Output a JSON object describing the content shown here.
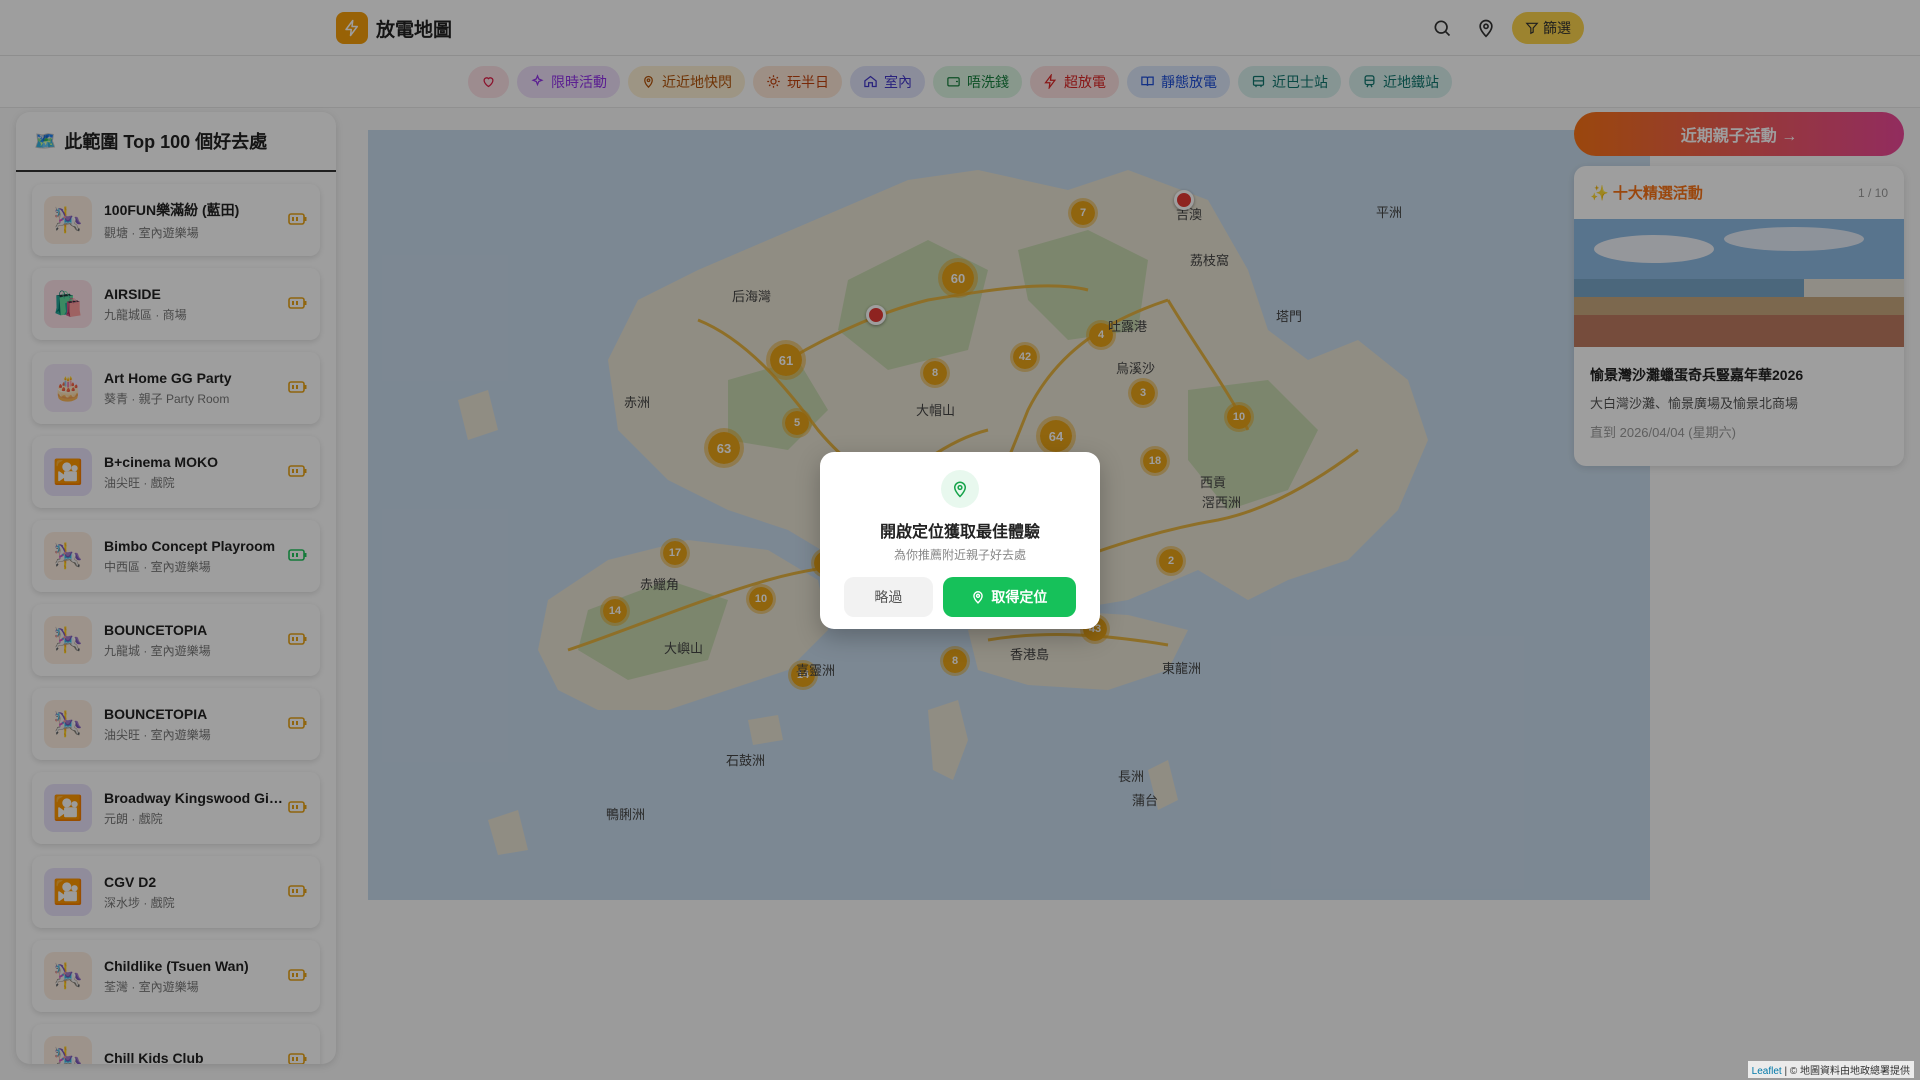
{
  "app": {
    "title": "放電地圖"
  },
  "chips": [
    {
      "label": "",
      "icon": "heart-icon",
      "color": "#e11d48",
      "bg": "#fde2e7"
    },
    {
      "label": "限時活動",
      "icon": "sparkles-icon",
      "color": "#9333ea",
      "bg": "#efe1fb"
    },
    {
      "label": "近近地快閃",
      "icon": "map-pin-icon",
      "color": "#b45309",
      "bg": "#fdf0d5"
    },
    {
      "label": "玩半日",
      "icon": "sun-icon",
      "color": "#c2410c",
      "bg": "#fde7d7"
    },
    {
      "label": "室內",
      "icon": "home-icon",
      "color": "#4338ca",
      "bg": "#e1e4fb"
    },
    {
      "label": "唔洗錢",
      "icon": "wallet-icon",
      "color": "#15803d",
      "bg": "#dcf5e3"
    },
    {
      "label": "超放電",
      "icon": "zap-icon",
      "color": "#dc2626",
      "bg": "#fde0e0"
    },
    {
      "label": "靜態放電",
      "icon": "book-icon",
      "color": "#1d4ed8",
      "bg": "#dde8fc"
    },
    {
      "label": "近巴士站",
      "icon": "bus-icon",
      "color": "#0f766e",
      "bg": "#d8f1ee"
    },
    {
      "label": "近地鐵站",
      "icon": "train-icon",
      "color": "#0f766e",
      "bg": "#d8f1ee"
    }
  ],
  "header": {
    "filter_label": "篩選"
  },
  "sidebar": {
    "title": "此範圍 Top 100 個好去處",
    "title_icon": "🗺️",
    "places": [
      {
        "name": "100FUN樂滿紛 (藍田)",
        "meta": "觀塘 · 室內遊樂場",
        "icon": "🎠",
        "bg": "#fdeee0",
        "battery": "#e8a317"
      },
      {
        "name": "AIRSIDE",
        "meta": "九龍城區 · 商場",
        "icon": "🛍️",
        "bg": "#fde2e8",
        "battery": "#e8a317"
      },
      {
        "name": "Art Home GG Party",
        "meta": "葵青 · 親子 Party Room",
        "icon": "🎂",
        "bg": "#f3e8fb",
        "battery": "#e8a317"
      },
      {
        "name": "B+cinema MOKO",
        "meta": "油尖旺 · 戲院",
        "icon": "🎦",
        "bg": "#e9e2fb",
        "battery": "#e8a317"
      },
      {
        "name": "Bimbo Concept Playroom",
        "meta": "中西區 · 室內遊樂場",
        "icon": "🎠",
        "bg": "#fdeee0",
        "battery": "#22c55e"
      },
      {
        "name": "BOUNCETOPIA",
        "meta": "九龍城 · 室內遊樂場",
        "icon": "🎠",
        "bg": "#fdeee0",
        "battery": "#e8a317"
      },
      {
        "name": "BOUNCETOPIA",
        "meta": "油尖旺 · 室內遊樂場",
        "icon": "🎠",
        "bg": "#fdeee0",
        "battery": "#e8a317"
      },
      {
        "name": "Broadway Kingswood Ginza",
        "meta": "元朗 · 戲院",
        "icon": "🎦",
        "bg": "#e9e2fb",
        "battery": "#e8a317"
      },
      {
        "name": "CGV D2",
        "meta": "深水埗 · 戲院",
        "icon": "🎦",
        "bg": "#e9e2fb",
        "battery": "#e8a317"
      },
      {
        "name": "Childlike (Tsuen Wan)",
        "meta": "荃灣 · 室內遊樂場",
        "icon": "🎠",
        "bg": "#fdeee0",
        "battery": "#e8a317"
      },
      {
        "name": "Chill Kids Club",
        "meta": "",
        "icon": "🎠",
        "bg": "#fdeee0",
        "battery": "#e8a317"
      }
    ]
  },
  "map": {
    "clusters": [
      "7",
      "60",
      "61",
      "63",
      "8",
      "42",
      "4",
      "5",
      "64",
      "3",
      "10",
      "18",
      "17",
      "7",
      "14",
      "10",
      "2",
      "43",
      "8",
      "14"
    ],
    "labels": [
      "平洲",
      "吉澳",
      "荔枝窩",
      "后海灣",
      "赤洲",
      "吐露港",
      "塔門",
      "烏溪沙",
      "大帽山",
      "西貢",
      "滘西洲",
      "赤鱲角",
      "大嶼山",
      "香港島",
      "東龍洲",
      "喜靈洲",
      "石鼓洲",
      "蒲台",
      "長洲",
      "鴨脷洲"
    ],
    "attribution_link": "Leaflet",
    "attribution_text": "| © 地圖資料由地政總署提供"
  },
  "right": {
    "events_button": "近期親子活動 →",
    "featured": {
      "title": "十大精選活動",
      "title_icon": "✨",
      "counter": "1 / 10",
      "event_title": "愉景灣沙灘蠟蛋奇兵豎嘉年華2026",
      "event_location": "大白灣沙灘、愉景廣場及愉景北商場",
      "event_date": "直到 2026/04/04 (星期六)"
    }
  },
  "modal": {
    "title": "開啟定位獲取最佳體驗",
    "subtitle": "為你推薦附近親子好去處",
    "skip_label": "略過",
    "locate_label": "取得定位"
  }
}
